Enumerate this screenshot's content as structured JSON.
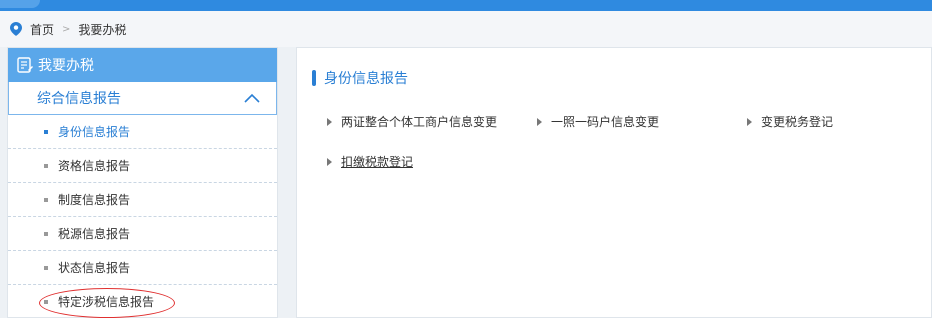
{
  "breadcrumb": {
    "home": "首页",
    "separator": ">",
    "current": "我要办税"
  },
  "sidebar": {
    "header": "我要办税",
    "group": "综合信息报告",
    "items": [
      {
        "label": "身份信息报告"
      },
      {
        "label": "资格信息报告"
      },
      {
        "label": "制度信息报告"
      },
      {
        "label": "税源信息报告"
      },
      {
        "label": "状态信息报告"
      },
      {
        "label": "特定涉税信息报告"
      }
    ]
  },
  "main": {
    "title": "身份信息报告",
    "links": [
      {
        "label": "两证整合个体工商户信息变更"
      },
      {
        "label": "一照一码户信息变更"
      },
      {
        "label": "变更税务登记"
      },
      {
        "label": "扣缴税款登记"
      }
    ]
  },
  "colors": {
    "accent": "#2a7fd4",
    "header_bg": "#5aa7ea",
    "topbar": "#2f8ae0",
    "highlight_ring": "#e03030"
  }
}
